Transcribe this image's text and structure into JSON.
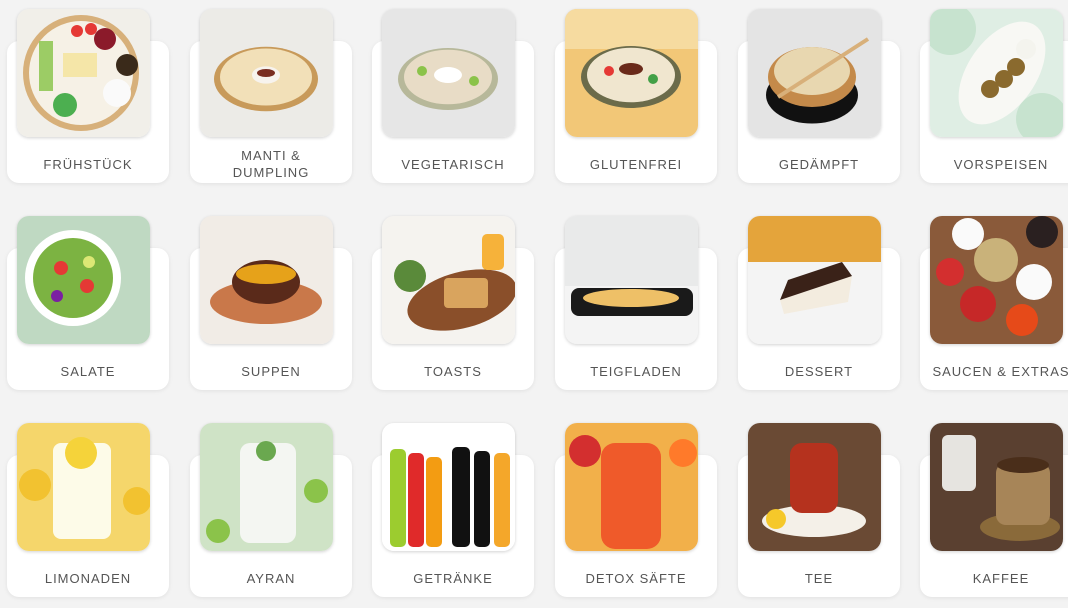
{
  "categories": [
    {
      "label": "FRÜHSTÜCK",
      "icon": "breakfast-platter-icon",
      "bg": "#f1efe9",
      "accent": "#cfa26a"
    },
    {
      "label": "MANTI & DUMPLING",
      "icon": "manti-plate-icon",
      "bg": "#ecebe7",
      "accent": "#c99a57"
    },
    {
      "label": "VEGETARISCH",
      "icon": "vegetarian-bowl-icon",
      "bg": "#e6e6e6",
      "accent": "#9aa57a"
    },
    {
      "label": "GLUTENFREI",
      "icon": "glutenfree-bowl-icon",
      "bg": "#f2c777",
      "accent": "#6b8b5a"
    },
    {
      "label": "GEDÄMPFT",
      "icon": "steamer-basket-icon",
      "bg": "#e4e4e4",
      "accent": "#b07d45"
    },
    {
      "label": "VORSPEISEN",
      "icon": "falafel-plate-icon",
      "bg": "#dfeee4",
      "accent": "#8a6a2e"
    },
    {
      "label": "SALATE",
      "icon": "salad-bowl-icon",
      "bg": "#bfd9c2",
      "accent": "#5a9a4a"
    },
    {
      "label": "SUPPEN",
      "icon": "soup-bowl-icon",
      "bg": "#f1ece6",
      "accent": "#c66a3a"
    },
    {
      "label": "TOASTS",
      "icon": "toast-board-icon",
      "bg": "#f5f3ef",
      "accent": "#b9824c"
    },
    {
      "label": "TEIGFLADEN",
      "icon": "flatbread-tray-icon",
      "bg": "#e9eaea",
      "accent": "#e0b35a"
    },
    {
      "label": "DESSERT",
      "icon": "cake-slice-icon",
      "bg": "#f4f4f4",
      "accent": "#e4a43b"
    },
    {
      "label": "SAUCEN & EXTRAS",
      "icon": "sauce-bowls-icon",
      "bg": "#8a5a3a",
      "accent": "#c43b2a"
    },
    {
      "label": "LIMONADEN",
      "icon": "lemonade-glass-icon",
      "bg": "#f5d66b",
      "accent": "#f2c230"
    },
    {
      "label": "AYRAN",
      "icon": "ayran-glass-icon",
      "bg": "#cfe3c6",
      "accent": "#4a8a3a"
    },
    {
      "label": "GETRÄNKE",
      "icon": "bottles-icon",
      "bg": "#ffffff",
      "accent": "#e02a2a"
    },
    {
      "label": "DETOX SÄFTE",
      "icon": "juice-glass-icon",
      "bg": "#f2b04a",
      "accent": "#ef5a2a"
    },
    {
      "label": "TEE",
      "icon": "tea-glass-icon",
      "bg": "#6a4a34",
      "accent": "#b5321e"
    },
    {
      "label": "KAFFEE",
      "icon": "coffee-cup-icon",
      "bg": "#5a4030",
      "accent": "#8a6a4a"
    }
  ]
}
